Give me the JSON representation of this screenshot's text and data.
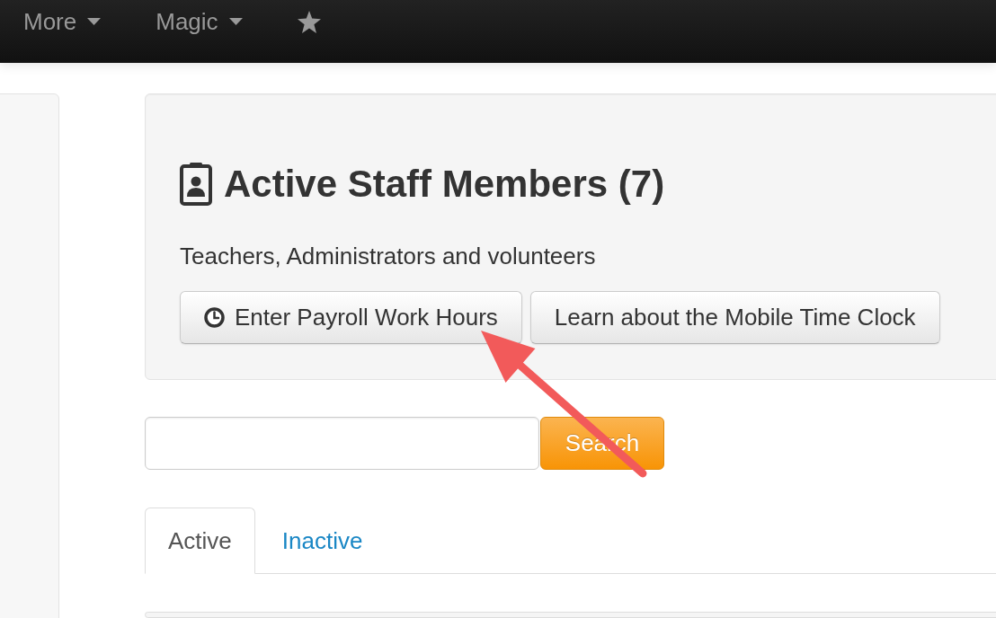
{
  "navbar": {
    "items": [
      {
        "kind": "dropdown",
        "label": "More"
      },
      {
        "kind": "dropdown",
        "label": "Magic"
      },
      {
        "kind": "icon"
      }
    ]
  },
  "staff_header": {
    "title": "Active Staff Members (7)",
    "subtitle": "Teachers, Administrators and volunteers",
    "buttons": [
      {
        "kind": "icon",
        "label": "Enter Payroll Work Hours"
      },
      {
        "kind": "text",
        "label": "Learn about the Mobile Time Clock"
      }
    ]
  },
  "search": {
    "button": "Search"
  },
  "tabs": [
    {
      "label": "Active",
      "selected": true
    },
    {
      "label": "Inactive",
      "selected": false
    }
  ],
  "annotations": [
    {
      "kind": "arrow"
    }
  ]
}
